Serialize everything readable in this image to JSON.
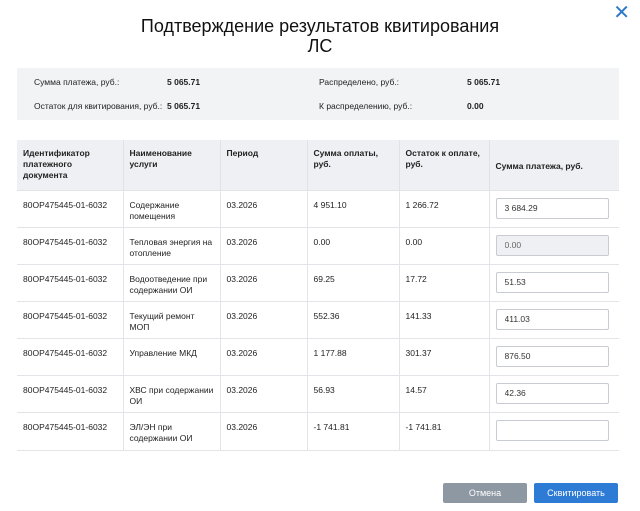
{
  "dialog": {
    "title_line1": "Подтверждение результатов квитирования",
    "title_line2": "ЛС",
    "close_glyph": "✕"
  },
  "summary": {
    "payment_sum_label": "Сумма платежа, руб.:",
    "payment_sum_value": "5 065.71",
    "distributed_label": "Распределено, руб.:",
    "distributed_value": "5 065.71",
    "remaining_label": "Остаток для квитирования, руб.:",
    "remaining_value": "5 065.71",
    "to_distribute_label": "К распределению, руб.:",
    "to_distribute_value": "0.00"
  },
  "table": {
    "headers": [
      "Идентификатор платежного документа",
      "Наименование услуги",
      "Период",
      "Сумма оплаты, руб.",
      "Остаток к оплате, руб.",
      "Сумма платежа, руб."
    ],
    "rows": [
      {
        "id": "80OP475445-01-6032",
        "service": "Содержание помещения",
        "period": "03.2026",
        "paid": "4 951.10",
        "remaining": "1 266.72",
        "payment": "3 684.29",
        "disabled": false
      },
      {
        "id": "80OP475445-01-6032",
        "service": "Тепловая энергия на отопление",
        "period": "03.2026",
        "paid": "0.00",
        "remaining": "0.00",
        "payment": "0.00",
        "disabled": true
      },
      {
        "id": "80OP475445-01-6032",
        "service": "Водоотведение при содержании ОИ",
        "period": "03.2026",
        "paid": "69.25",
        "remaining": "17.72",
        "payment": "51.53",
        "disabled": false
      },
      {
        "id": "80OP475445-01-6032",
        "service": "Текущий ремонт МОП",
        "period": "03.2026",
        "paid": "552.36",
        "remaining": "141.33",
        "payment": "411.03",
        "disabled": false
      },
      {
        "id": "80OP475445-01-6032",
        "service": "Управление МКД",
        "period": "03.2026",
        "paid": "1 177.88",
        "remaining": "301.37",
        "payment": "876.50",
        "disabled": false
      },
      {
        "id": "80OP475445-01-6032",
        "service": "ХВС при содержании ОИ",
        "period": "03.2026",
        "paid": "56.93",
        "remaining": "14.57",
        "payment": "42.36",
        "disabled": false
      },
      {
        "id": "80OP475445-01-6032",
        "service": "ЭЛ/ЭН при содержании ОИ",
        "period": "03.2026",
        "paid": "-1 741.81",
        "remaining": "-1 741.81",
        "payment": "",
        "disabled": false
      }
    ]
  },
  "footer": {
    "cancel_label": "Отмена",
    "confirm_label": "Сквитировать"
  },
  "colors": {
    "accent": "#2e7bd6",
    "cancel": "#8e98a3",
    "summary_bg": "#f2f3f5"
  }
}
